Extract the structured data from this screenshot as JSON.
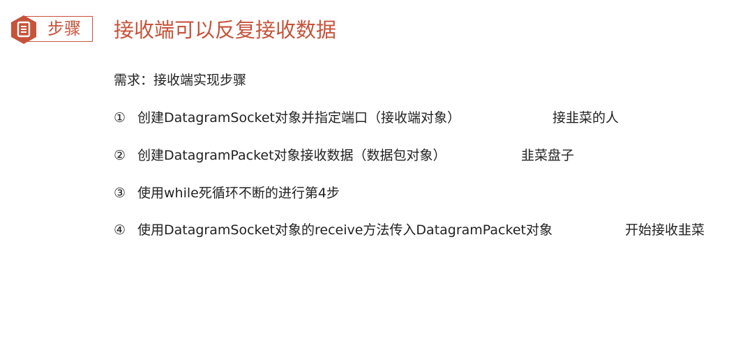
{
  "header": {
    "badge_icon": "document-icon",
    "badge_label": "步骤",
    "title": "接收端可以反复接收数据",
    "accent_color": "#c6533a"
  },
  "content": {
    "requirement": "需求：接收端实现步骤",
    "steps": [
      {
        "num": "①",
        "text": "创建DatagramSocket对象并指定端口（接收端对象）",
        "note": "接韭菜的人"
      },
      {
        "num": "②",
        "text": "创建DatagramPacket对象接收数据（数据包对象）",
        "note": "韭菜盘子"
      },
      {
        "num": "③",
        "text": "使用while死循环不断的进行第4步",
        "note": ""
      },
      {
        "num": "④",
        "text": "使用DatagramSocket对象的receive方法传入DatagramPacket对象",
        "note": "开始接收韭菜"
      }
    ]
  }
}
